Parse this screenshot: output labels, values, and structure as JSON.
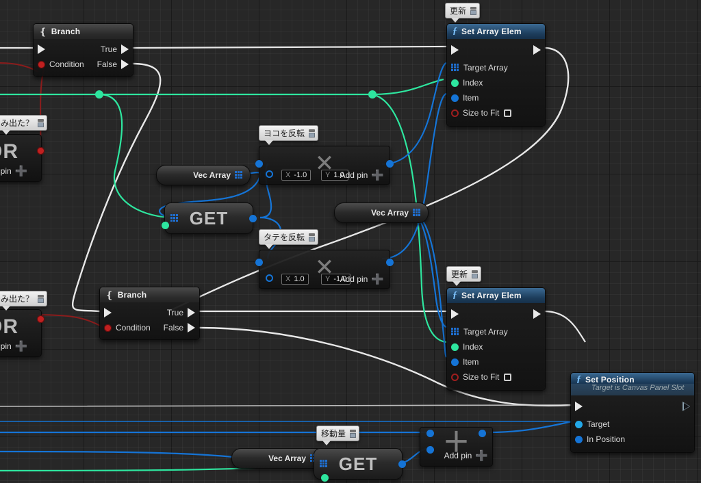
{
  "app": {
    "title": "Unreal Engine Blueprint Event Graph"
  },
  "canvas": {
    "background": "#272727",
    "grid_minor": 16,
    "grid_major": 128
  },
  "wire_colors": {
    "exec": "#e8e8e8",
    "integer": "#2ee69f",
    "vector": "#1574d6",
    "boolean": "#8c1c1c",
    "object": "#23a8e8"
  },
  "comments": [
    {
      "id": "c-hamidita-top",
      "text": "み出た？"
    },
    {
      "id": "c-hamidita-bot",
      "text": "み出た？"
    },
    {
      "id": "c-koushin-top",
      "text": "更新"
    },
    {
      "id": "c-yoko",
      "text": "ヨコを反転"
    },
    {
      "id": "c-tate",
      "text": "タテを反転"
    },
    {
      "id": "c-koushin-bot",
      "text": "更新"
    },
    {
      "id": "c-idouryou",
      "text": "移動量"
    }
  ],
  "nodes": {
    "or_top": {
      "title": "OR",
      "add_pin": "Add pin"
    },
    "or_bottom": {
      "title": "OR",
      "add_pin": "Add pin"
    },
    "branch_top": {
      "title": "Branch",
      "in_exec": "",
      "condition": "Condition",
      "true": "True",
      "false": "False"
    },
    "branch_bottom": {
      "title": "Branch",
      "in_exec": "",
      "condition": "Condition",
      "true": "True",
      "false": "False"
    },
    "set_array_elem_top": {
      "title": "Set Array Elem",
      "pins": [
        "Target Array",
        "Index",
        "Item",
        "Size to Fit"
      ],
      "size_to_fit_checked": false
    },
    "set_array_elem_bottom": {
      "title": "Set Array Elem",
      "pins": [
        "Target Array",
        "Index",
        "Item",
        "Size to Fit"
      ],
      "size_to_fit_checked": false
    },
    "set_position": {
      "title": "Set Position",
      "subtitle": "Target is Canvas Panel Slot",
      "pins": [
        "Target",
        "In Position"
      ]
    },
    "vec_array_1": {
      "title": "Vec Array"
    },
    "vec_array_2": {
      "title": "Vec Array"
    },
    "vec_array_3": {
      "title": "Vec Array"
    },
    "get_1": {
      "title": "GET"
    },
    "get_2": {
      "title": "GET"
    },
    "multiply_yoko": {
      "glyph": "✕",
      "x_label": "X",
      "x_value": "-1.0",
      "y_label": "Y",
      "y_value": "1.0",
      "add_pin": "Add pin"
    },
    "multiply_tate": {
      "glyph": "✕",
      "x_label": "X",
      "x_value": "1.0",
      "y_label": "Y",
      "y_value": "-1.0",
      "add_pin": "Add pin"
    },
    "add_node": {
      "glyph": "＋",
      "add_pin": "Add pin"
    }
  }
}
